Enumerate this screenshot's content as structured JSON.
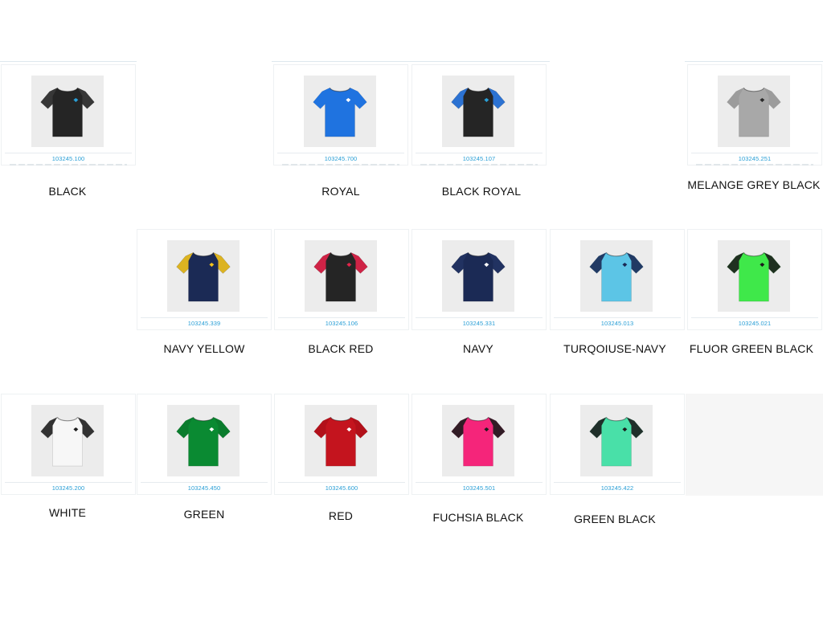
{
  "products": [
    {
      "code": "103245.100",
      "color_name": "BLACK",
      "body_color": "#252525",
      "accent_color": "#3a3a3a",
      "logo_color": "#2a9fd6"
    },
    {
      "code": "103245.700",
      "color_name": "ROYAL",
      "body_color": "#1f73e0",
      "accent_color": "#1f73e0",
      "logo_color": "#ffffff"
    },
    {
      "code": "103245.107",
      "color_name": "BLACK ROYAL",
      "body_color": "#252525",
      "accent_color": "#2d7be5",
      "logo_color": "#2a9fd6"
    },
    {
      "code": "103245.251",
      "color_name": "MELANGE GREY BLACK",
      "body_color": "#a8a8a8",
      "accent_color": "#9a9a9a",
      "logo_color": "#2a2a2a"
    },
    {
      "code": "103245.339",
      "color_name": "NAVY YELLOW",
      "body_color": "#1b2a55",
      "accent_color": "#f2c21c",
      "logo_color": "#f2c21c"
    },
    {
      "code": "103245.106",
      "color_name": "BLACK RED",
      "body_color": "#252525",
      "accent_color": "#e2244a",
      "logo_color": "#e2244a"
    },
    {
      "code": "103245.331",
      "color_name": "NAVY",
      "body_color": "#1b2a55",
      "accent_color": "#223363",
      "logo_color": "#ffffff"
    },
    {
      "code": "103245.013",
      "color_name": "TURQOIUSE-NAVY",
      "body_color": "#5cc5e6",
      "accent_color": "#1b2a55",
      "logo_color": "#1b2a55"
    },
    {
      "code": "103245.021",
      "color_name": "FLUOR GREEN BLACK",
      "body_color": "#3fe84a",
      "accent_color": "#1c1c1c",
      "logo_color": "#1c1c1c"
    },
    {
      "code": "103245.200",
      "color_name": "WHITE",
      "body_color": "#f7f7f7",
      "accent_color": "#1c1c1c",
      "logo_color": "#1c1c1c"
    },
    {
      "code": "103245.450",
      "color_name": "GREEN",
      "body_color": "#0a8a32",
      "accent_color": "#0a7a2c",
      "logo_color": "#ffffff"
    },
    {
      "code": "103245.600",
      "color_name": "RED",
      "body_color": "#c4141e",
      "accent_color": "#b01019",
      "logo_color": "#ffffff"
    },
    {
      "code": "103245.501",
      "color_name": "FUCHSIA BLACK",
      "body_color": "#f5257a",
      "accent_color": "#1c1c1c",
      "logo_color": "#1c1c1c"
    },
    {
      "code": "103245.422",
      "color_name": "GREEN BLACK",
      "body_color": "#49e0a8",
      "accent_color": "#1c1c1c",
      "logo_color": "#1c1c1c"
    }
  ]
}
